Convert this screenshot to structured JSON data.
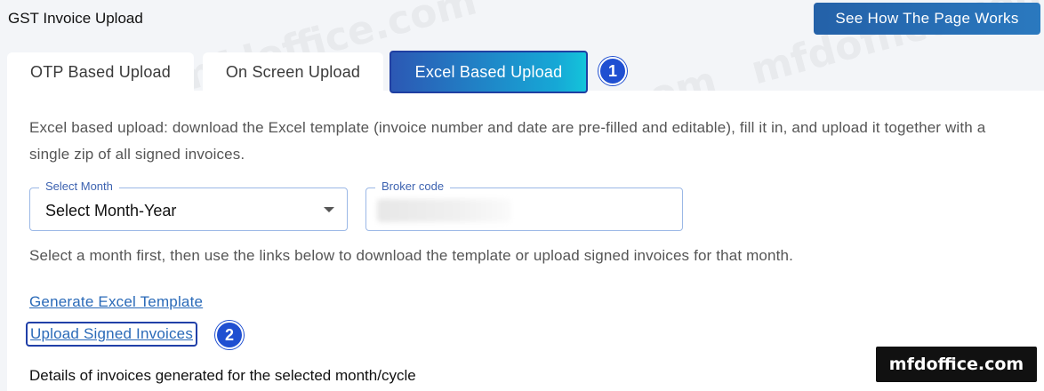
{
  "page": {
    "title": "GST Invoice Upload"
  },
  "header": {
    "how_button": "See How The Page Works"
  },
  "tabs": [
    {
      "label": "OTP Based Upload",
      "active": false
    },
    {
      "label": "On Screen Upload",
      "active": false
    },
    {
      "label": "Excel Based Upload",
      "active": true
    }
  ],
  "annotations": {
    "step1": "1",
    "step2": "2"
  },
  "main": {
    "description": "Excel based upload: download the Excel template (invoice number and date are pre-filled and editable), fill it in, and upload it together with a single zip of all signed invoices.",
    "month_field": {
      "label": "Select Month",
      "value": "Select Month-Year"
    },
    "broker_field": {
      "label": "Broker code"
    },
    "hint": "Select a month first, then use the links below to download the template or upload signed invoices for that month.",
    "generate_link": "Generate Excel Template",
    "upload_link": "Upload Signed Invoices",
    "details_heading": "Details of invoices generated for the selected month/cycle"
  },
  "watermark": {
    "text": "mfdoffice.com"
  },
  "brand": {
    "text": "mfdoffice.com"
  },
  "colors": {
    "accent": "#2a6ab8",
    "badge": "#1f4fd1",
    "active_tab_start": "#2c58b4",
    "active_tab_end": "#14c4da"
  }
}
